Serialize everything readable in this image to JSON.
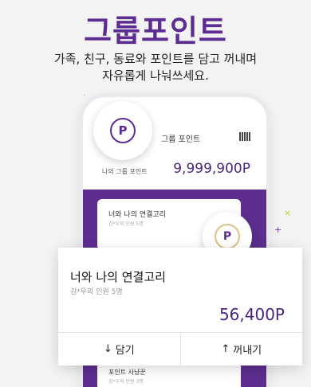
{
  "headline": "그룹포인트",
  "subline": {
    "line1": "가족, 친구, 동료와 포인트를 담고 꺼내며",
    "line2": "자유롭게 나눠쓰세요."
  },
  "phone": {
    "title": "그룹 포인트",
    "my_point_label": "나의 그룹 포인트",
    "my_point_value": "9,999,900P",
    "inner_card_title": "너와 나의 연결고리",
    "inner_card_sub": "김*우외 인원 5명",
    "bottom_card_title": "포인트 사냥꾼",
    "bottom_card_sub": "김*우외 인원 3명"
  },
  "coin_symbol": "P",
  "card": {
    "title": "너와 나의 연결고리",
    "subtitle": "김*우외 인원 5명",
    "amount": "56,400P",
    "deposit_label": "담기",
    "withdraw_label": "꺼내기",
    "deposit_arrow": "↓",
    "withdraw_arrow": "↑"
  },
  "colors": {
    "brand_purple": "#5b2d91",
    "spark_green": "#b5d334",
    "spark_purple": "#6b3aa0"
  }
}
